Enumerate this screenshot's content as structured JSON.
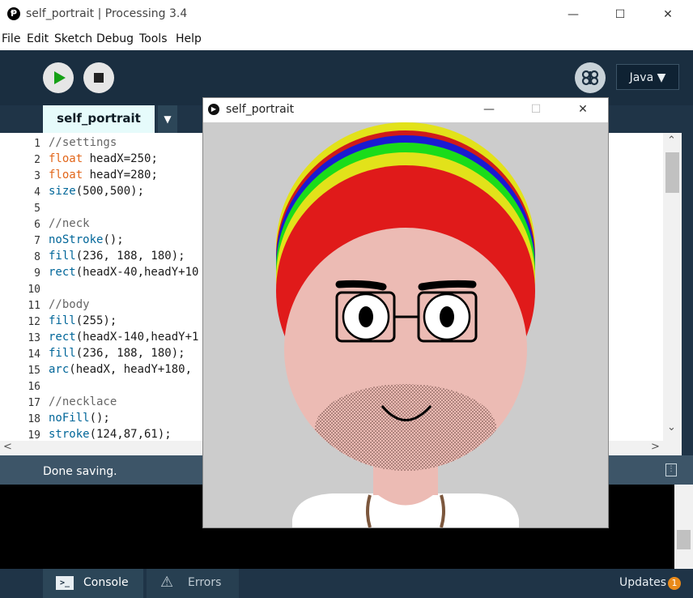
{
  "window": {
    "app_icon": "Ᵽ",
    "title": "self_portrait | Processing 3.4",
    "minimize": "—",
    "maximize": "☐",
    "close": "✕"
  },
  "menu": [
    "File",
    "Edit",
    "Sketch",
    "Debug",
    "Tools",
    "Help"
  ],
  "toolbar": {
    "run_icon": "play-icon",
    "stop_icon": "stop-icon",
    "debug_icon": "butterfly-icon",
    "mode_label": "Java ▼"
  },
  "tabs": {
    "active": "self_portrait",
    "arrow": "▼"
  },
  "editor": {
    "lines": [
      {
        "n": "1",
        "parts": [
          {
            "t": "//settings",
            "c": "cmt"
          }
        ]
      },
      {
        "n": "2",
        "parts": [
          {
            "t": "float",
            "c": "type"
          },
          {
            "t": " headX=250;",
            "c": "plain"
          }
        ]
      },
      {
        "n": "3",
        "parts": [
          {
            "t": "float",
            "c": "type"
          },
          {
            "t": " headY=280;",
            "c": "plain"
          }
        ]
      },
      {
        "n": "4",
        "parts": [
          {
            "t": "size",
            "c": "fn"
          },
          {
            "t": "(500,500);",
            "c": "plain"
          }
        ]
      },
      {
        "n": "5",
        "parts": []
      },
      {
        "n": "6",
        "parts": [
          {
            "t": "//neck",
            "c": "cmt"
          }
        ]
      },
      {
        "n": "7",
        "parts": [
          {
            "t": "noStroke",
            "c": "fn"
          },
          {
            "t": "();",
            "c": "plain"
          }
        ]
      },
      {
        "n": "8",
        "parts": [
          {
            "t": "fill",
            "c": "fn"
          },
          {
            "t": "(236, 188, 180);",
            "c": "plain"
          }
        ]
      },
      {
        "n": "9",
        "parts": [
          {
            "t": "rect",
            "c": "fn"
          },
          {
            "t": "(headX-40,headY+10",
            "c": "plain"
          }
        ]
      },
      {
        "n": "10",
        "parts": []
      },
      {
        "n": "11",
        "parts": [
          {
            "t": "//body",
            "c": "cmt"
          }
        ]
      },
      {
        "n": "12",
        "parts": [
          {
            "t": "fill",
            "c": "fn"
          },
          {
            "t": "(255);",
            "c": "plain"
          }
        ]
      },
      {
        "n": "13",
        "parts": [
          {
            "t": "rect",
            "c": "fn"
          },
          {
            "t": "(headX-140,headY+1",
            "c": "plain"
          }
        ]
      },
      {
        "n": "14",
        "parts": [
          {
            "t": "fill",
            "c": "fn"
          },
          {
            "t": "(236, 188, 180);",
            "c": "plain"
          }
        ]
      },
      {
        "n": "15",
        "parts": [
          {
            "t": "arc",
            "c": "fn"
          },
          {
            "t": "(headX, headY+180, ",
            "c": "plain"
          }
        ]
      },
      {
        "n": "16",
        "parts": []
      },
      {
        "n": "17",
        "parts": [
          {
            "t": "//necklace",
            "c": "cmt"
          }
        ]
      },
      {
        "n": "18",
        "parts": [
          {
            "t": "noFill",
            "c": "fn"
          },
          {
            "t": "();",
            "c": "plain"
          }
        ]
      },
      {
        "n": "19",
        "parts": [
          {
            "t": "stroke",
            "c": "fn"
          },
          {
            "t": "(124,87,61);",
            "c": "plain"
          }
        ]
      }
    ]
  },
  "scroll": {
    "up": "⌃",
    "down": "⌄",
    "left": "<",
    "right": ">"
  },
  "status": {
    "message": "Done saving.",
    "icon": "clipboard-icon"
  },
  "bottom_tabs": {
    "console_label": "Console",
    "console_icon": ">_",
    "errors_label": "Errors",
    "errors_icon": "⚠",
    "updates_label": "Updates",
    "updates_count": "1"
  },
  "sketch_window": {
    "title": "self_portrait",
    "minimize": "—",
    "maximize": "☐",
    "close": "✕"
  },
  "colors": {
    "background": "#cccccc",
    "skin": "#ecbbb4",
    "hat_red": "#e01a1a",
    "hat_yellow": "#e2e21a",
    "hat_green": "#1adc1a",
    "hat_blue": "#1a1ad2",
    "necklace": "#7c573d"
  }
}
